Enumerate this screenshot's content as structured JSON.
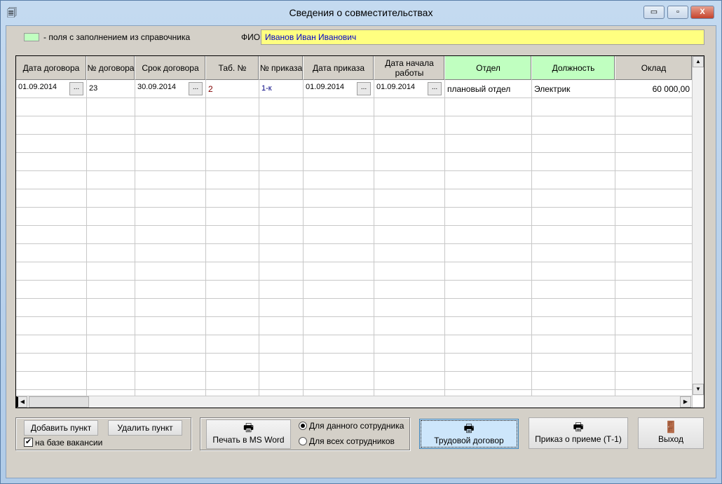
{
  "window": {
    "title": "Сведения о совместительствах",
    "minimize": "▭",
    "maximize": "▫",
    "close": "X"
  },
  "legend": {
    "text": "- поля с заполнением из справочника",
    "color": "#c0ffc0"
  },
  "fio": {
    "label": "ФИО",
    "value": "Иванов Иван Иванович"
  },
  "grid": {
    "columns": [
      {
        "label": "Дата договора"
      },
      {
        "label": "№ договора"
      },
      {
        "label": "Срок договора"
      },
      {
        "label": "Таб. №"
      },
      {
        "label": "№ приказа"
      },
      {
        "label": "Дата приказа"
      },
      {
        "label": "Дата начала работы"
      },
      {
        "label": "Отдел",
        "lookup": true
      },
      {
        "label": "Должность",
        "lookup": true
      },
      {
        "label": "Оклад"
      }
    ],
    "rows": [
      {
        "contract_date": "01.09.2014",
        "contract_no": "23",
        "term": "30.09.2014",
        "tab_no": "2",
        "order_no": "1-к",
        "order_date": "01.09.2014",
        "start_date": "01.09.2014",
        "department": "плановый отдел",
        "position": "Электрик",
        "salary": "60 000,00"
      }
    ],
    "ellipsis": "..."
  },
  "buttons": {
    "add": "Добавить пункт",
    "delete": "Удалить пункт",
    "vacancy": "на базе вакансии",
    "vacancy_checked": true,
    "print_word": "Печать в MS Word",
    "radio_this": "Для данного сотрудника",
    "radio_all": "Для всех сотрудников",
    "selected_radio": "this",
    "labor_contract": "Трудовой договор",
    "hire_order": "Приказ о приеме (Т-1)",
    "exit": "Выход"
  }
}
